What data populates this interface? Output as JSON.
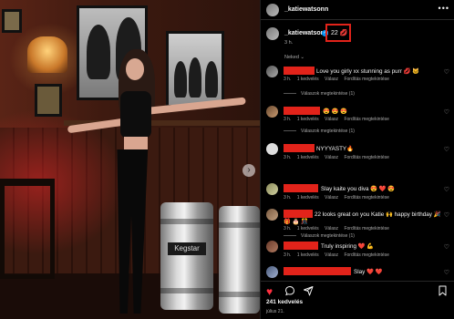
{
  "post": {
    "username": "_katiewatsonn",
    "more_icon": "more-horizontal-icon",
    "caption_text": "22",
    "caption_emoji": "💋",
    "caption_time": "3 h.",
    "translate_label": "Neked ⌄",
    "photo_label": "Kegstar",
    "carousel_next": "›"
  },
  "comments": [
    {
      "text": "Love you girly xx stunning as purr 💋 🐱",
      "time": "3 h.",
      "likes": "1 kedvelés",
      "reply": "Válasz",
      "translate": "Fordítás megtekintése",
      "replies": "Válaszok megtekintése (1)"
    },
    {
      "text": "😍 😍 😍",
      "time": "3 h.",
      "likes": "1 kedvelés",
      "reply": "Válasz",
      "translate": "Fordítás megtekintése",
      "replies": "Válaszok megtekintése (1)"
    },
    {
      "text": "NYYYASTY🔥",
      "time": "3 h.",
      "likes": "1 kedvelés",
      "reply": "Válasz",
      "translate": "Fordítás megtekintése",
      "replies": ""
    },
    {
      "text": "Slay kaite you diva 😍 ❤️ 😍",
      "time": "3 h.",
      "likes": "1 kedvelés",
      "reply": "Válasz",
      "translate": "Fordítás megtekintése",
      "replies": ""
    },
    {
      "text": "22 looks great on you Katie 🙌 happy birthday 🎉",
      "text2": "🎁 🎂 🎊",
      "time": "3 h.",
      "likes": "1 kedvelés",
      "reply": "Válasz",
      "translate": "Fordítás megtekintése",
      "replies": "Válaszok megtekintése (1)"
    },
    {
      "text": "Truly inspiring ❤️ 💪",
      "time": "3 h.",
      "likes": "1 kedvelés",
      "reply": "Válasz",
      "translate": "Fordítás megtekintése",
      "replies": ""
    },
    {
      "text": "Slay ❤️ ❤️",
      "time": "",
      "likes": "",
      "reply": "",
      "translate": "",
      "replies": ""
    }
  ],
  "actions": {
    "like_icon": "heart-filled-icon",
    "comment_icon": "comment-icon",
    "share_icon": "share-icon",
    "save_icon": "bookmark-icon",
    "like_color": "#ff3040"
  },
  "footer": {
    "likes": "241 kedvelés",
    "date": "július 21."
  },
  "colors": {
    "redaction": "#e2231a",
    "highlight": "#e2231a",
    "verified": "#0095f6"
  }
}
